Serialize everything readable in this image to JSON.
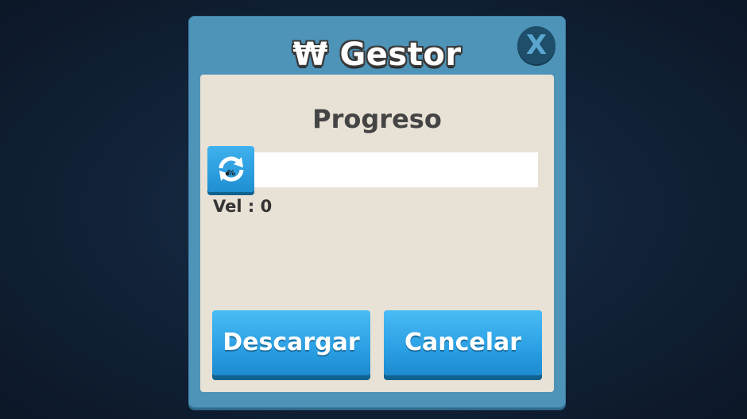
{
  "dialog": {
    "title": "₩ Gestor",
    "close_label": "X"
  },
  "panel": {
    "heading": "Progreso",
    "progress": {
      "fraction": 0,
      "icon": "refresh-percent-icon"
    },
    "speed_label": "Vel : 0"
  },
  "buttons": {
    "download_label": "Descargar",
    "cancel_label": "Cancelar"
  },
  "colors": {
    "frame": "#4e93b8",
    "panel": "#e8e1d5",
    "button": "#2a9fe3",
    "close_bg": "#1e4e6a"
  }
}
